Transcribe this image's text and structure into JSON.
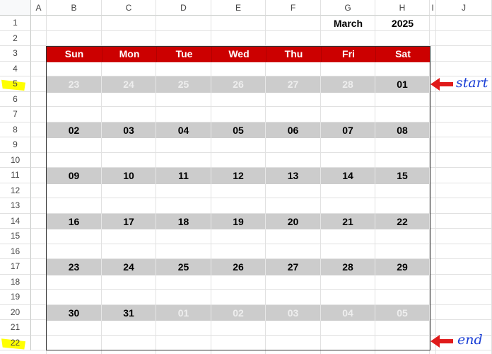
{
  "columns": [
    "A",
    "B",
    "C",
    "D",
    "E",
    "F",
    "G",
    "H",
    "I",
    "J"
  ],
  "rows": [
    "1",
    "2",
    "3",
    "4",
    "5",
    "6",
    "7",
    "8",
    "9",
    "10",
    "11",
    "12",
    "13",
    "14",
    "15",
    "16",
    "17",
    "18",
    "19",
    "20",
    "21",
    "22"
  ],
  "highlighted_rows": [
    "5",
    "22"
  ],
  "highlight_color": "#ffff00",
  "header": {
    "month": "March",
    "year": "2025"
  },
  "calendar": {
    "header_color": "#cc0000",
    "date_row_color": "#cccccc",
    "weekdays": [
      "Sun",
      "Mon",
      "Tue",
      "Wed",
      "Thu",
      "Fri",
      "Sat"
    ],
    "weeks": [
      {
        "days": [
          {
            "d": "23",
            "current": false
          },
          {
            "d": "24",
            "current": false
          },
          {
            "d": "25",
            "current": false
          },
          {
            "d": "26",
            "current": false
          },
          {
            "d": "27",
            "current": false
          },
          {
            "d": "28",
            "current": false
          },
          {
            "d": "01",
            "current": true
          }
        ]
      },
      {
        "days": [
          {
            "d": "02",
            "current": true
          },
          {
            "d": "03",
            "current": true
          },
          {
            "d": "04",
            "current": true
          },
          {
            "d": "05",
            "current": true
          },
          {
            "d": "06",
            "current": true
          },
          {
            "d": "07",
            "current": true
          },
          {
            "d": "08",
            "current": true
          }
        ]
      },
      {
        "days": [
          {
            "d": "09",
            "current": true
          },
          {
            "d": "10",
            "current": true
          },
          {
            "d": "11",
            "current": true
          },
          {
            "d": "12",
            "current": true
          },
          {
            "d": "13",
            "current": true
          },
          {
            "d": "14",
            "current": true
          },
          {
            "d": "15",
            "current": true
          }
        ]
      },
      {
        "days": [
          {
            "d": "16",
            "current": true
          },
          {
            "d": "17",
            "current": true
          },
          {
            "d": "18",
            "current": true
          },
          {
            "d": "19",
            "current": true
          },
          {
            "d": "20",
            "current": true
          },
          {
            "d": "21",
            "current": true
          },
          {
            "d": "22",
            "current": true
          }
        ]
      },
      {
        "days": [
          {
            "d": "23",
            "current": true
          },
          {
            "d": "24",
            "current": true
          },
          {
            "d": "25",
            "current": true
          },
          {
            "d": "26",
            "current": true
          },
          {
            "d": "27",
            "current": true
          },
          {
            "d": "28",
            "current": true
          },
          {
            "d": "29",
            "current": true
          }
        ]
      },
      {
        "days": [
          {
            "d": "30",
            "current": true
          },
          {
            "d": "31",
            "current": true
          },
          {
            "d": "01",
            "current": false
          },
          {
            "d": "02",
            "current": false
          },
          {
            "d": "03",
            "current": false
          },
          {
            "d": "04",
            "current": false
          },
          {
            "d": "05",
            "current": false
          }
        ]
      }
    ]
  },
  "annotations": {
    "start": "start",
    "end": "end",
    "arrow_color": "#e01b1b"
  }
}
